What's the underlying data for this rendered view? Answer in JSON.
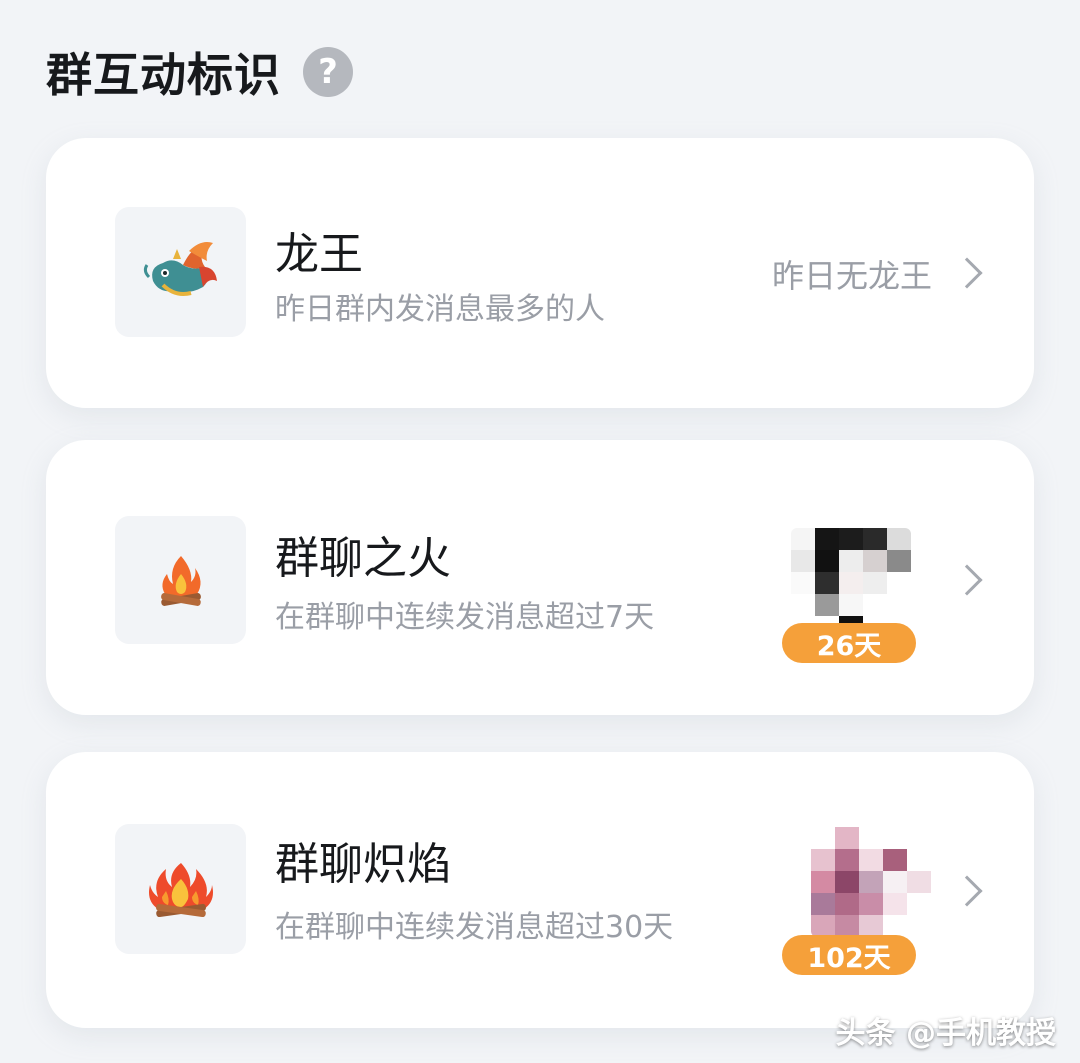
{
  "section": {
    "title": "群互动标识",
    "help_icon": "?"
  },
  "items": [
    {
      "icon": "dragon-icon",
      "title": "龙王",
      "description": "昨日群内发消息最多的人",
      "status_text": "昨日无龙王"
    },
    {
      "icon": "campfire-icon",
      "title": "群聊之火",
      "description": "在群聊中连续发消息超过7天",
      "badge": "26天"
    },
    {
      "icon": "big-fire-icon",
      "title": "群聊炽焰",
      "description": "在群聊中连续发消息超过30天",
      "badge": "102天"
    }
  ],
  "watermark": "头条 @手机教授",
  "colors": {
    "background": "#f2f4f7",
    "card": "#ffffff",
    "badge": "#f5a03a",
    "secondary_text": "#9a9ea6"
  }
}
